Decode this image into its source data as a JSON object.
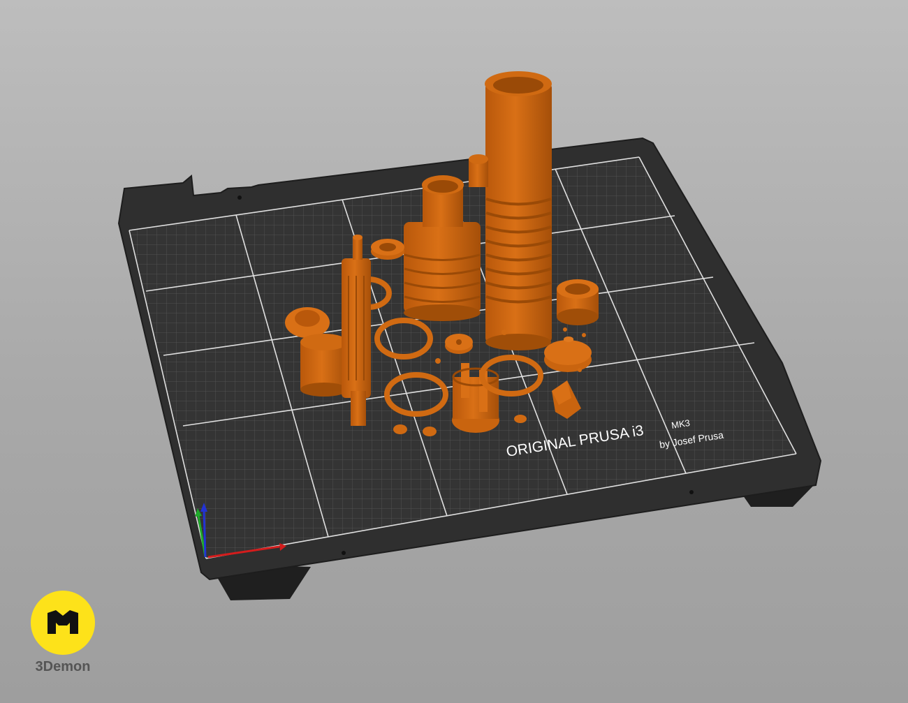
{
  "bed": {
    "brand_line": "ORIGINAL PRUSA i3",
    "model": "MK3",
    "byline": "by Josef Prusa"
  },
  "colors": {
    "part": "#d4690f",
    "part_shadow": "#a04e08",
    "bed": "#2f2f2f",
    "bed_frame": "#242424",
    "grid": "#d9d9d9",
    "axis_x": "#d41c1c",
    "axis_y": "#1faa2a",
    "axis_z": "#2233d4",
    "logo": "#fde21a"
  },
  "axes": {
    "icon": "xyz-axes-icon"
  },
  "logo": {
    "text": "3Demon",
    "icon": "3demon-logo-icon"
  }
}
